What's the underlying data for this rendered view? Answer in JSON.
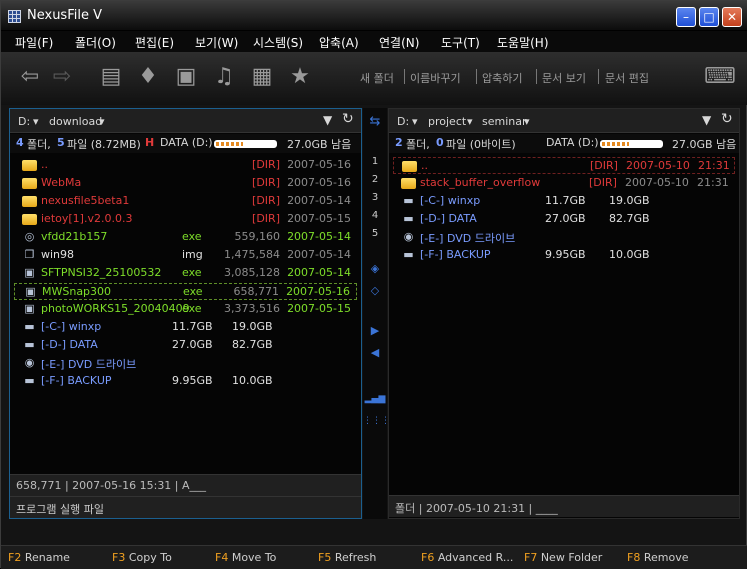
{
  "window": {
    "title": "NexusFile V"
  },
  "menu": [
    "파일(F)",
    "폴더(O)",
    "편집(E)",
    "보기(W)",
    "시스템(S)",
    "압축(A)",
    "연결(N)",
    "도구(T)",
    "도움말(H)"
  ],
  "toolbar": {
    "text_buttons": [
      "새 폴더",
      "이름바꾸기",
      "압축하기",
      "문서 보기",
      "문서 편집"
    ]
  },
  "left": {
    "drive": "D:",
    "path": "download",
    "summary_folders": "4",
    "summary_folders_label": "폴더,",
    "summary_files": "5",
    "summary_files_label": "파일 (8.72MB)",
    "summary_flag": "H",
    "drive_label": "DATA (D:)",
    "drive_fill": 0.45,
    "free": "27.0GB 남음",
    "rows": [
      {
        "icon": "folder",
        "name": "..",
        "type": "",
        "size": "[DIR]",
        "date": "2007-05-16",
        "color": "red"
      },
      {
        "icon": "folder",
        "name": "WebMa",
        "type": "",
        "size": "[DIR]",
        "date": "2007-05-16",
        "color": "red"
      },
      {
        "icon": "folder",
        "name": "nexusfile5beta1",
        "type": "",
        "size": "[DIR]",
        "date": "2007-05-14",
        "color": "red"
      },
      {
        "icon": "folder",
        "name": "ietoy[1].v2.0.0.3",
        "type": "",
        "size": "[DIR]",
        "date": "2007-05-15",
        "color": "red"
      },
      {
        "icon": "cd",
        "name": "vfdd21b157",
        "type": "exe",
        "size": "559,160",
        "date": "2007-05-14",
        "color": "green"
      },
      {
        "icon": "doc",
        "name": "win98",
        "type": "img",
        "size": "1,475,584",
        "date": "2007-05-14",
        "color": "white"
      },
      {
        "icon": "app",
        "name": "SFTPNSI32_25100532",
        "type": "exe",
        "size": "3,085,128",
        "date": "2007-05-14",
        "color": "green"
      },
      {
        "icon": "app",
        "name": "MWSnap300",
        "type": "exe",
        "size": "658,771",
        "date": "2007-05-16",
        "color": "green"
      },
      {
        "icon": "app",
        "name": "photoWORKS15_20040409",
        "type": "exe",
        "size": "3,373,516",
        "date": "2007-05-15",
        "color": "green"
      },
      {
        "icon": "drive",
        "name": "[-C-] winxp",
        "type": "11.7GB",
        "size": "19.0GB",
        "date": "",
        "color": "blue"
      },
      {
        "icon": "drive",
        "name": "[-D-] DATA",
        "type": "27.0GB",
        "size": "82.7GB",
        "date": "",
        "color": "blue"
      },
      {
        "icon": "dvd",
        "name": "[-E-] DVD 드라이브",
        "type": "",
        "size": "",
        "date": "",
        "color": "blue"
      },
      {
        "icon": "drive",
        "name": "[-F-] BACKUP",
        "type": "9.95GB",
        "size": "10.0GB",
        "date": "",
        "color": "blue"
      }
    ],
    "status_line": "658,771 | 2007-05-16 15:31 | A___",
    "description": "프로그램 실행 파일"
  },
  "right": {
    "drive": "D:",
    "path1": "project",
    "path2": "seminar",
    "summary_folders": "2",
    "summary_folders_label": "폴더,",
    "summary_files": "0",
    "summary_files_label": "파일 (0바이트)",
    "drive_label": "DATA (D:)",
    "drive_fill": 0.45,
    "free": "27.0GB 남음",
    "rows": [
      {
        "icon": "folder",
        "name": "..",
        "size": "[DIR]",
        "date": "2007-05-10",
        "time": "21:31",
        "color": "red"
      },
      {
        "icon": "folder",
        "name": "stack_buffer_overflow",
        "size": "[DIR]",
        "date": "2007-05-10",
        "time": "21:31",
        "color": "red"
      },
      {
        "icon": "drive",
        "name": "[-C-] winxp",
        "size": "11.7GB",
        "date": "19.0GB",
        "time": "",
        "color": "blue"
      },
      {
        "icon": "drive",
        "name": "[-D-] DATA",
        "size": "27.0GB",
        "date": "82.7GB",
        "time": "",
        "color": "blue"
      },
      {
        "icon": "dvd",
        "name": "[-E-] DVD 드라이브",
        "size": "",
        "date": "",
        "time": "",
        "color": "blue"
      },
      {
        "icon": "drive",
        "name": "[-F-] BACKUP",
        "size": "9.95GB",
        "date": "10.0GB",
        "time": "",
        "color": "blue"
      }
    ],
    "status_line": "폴더 | 2007-05-10 21:31 | ____"
  },
  "middle": {
    "numbers": [
      "1",
      "2",
      "3",
      "4",
      "5"
    ]
  },
  "fkeys": [
    {
      "key": "F2",
      "label": "Rename"
    },
    {
      "key": "F3",
      "label": "Copy To"
    },
    {
      "key": "F4",
      "label": "Move To"
    },
    {
      "key": "F5",
      "label": "Refresh"
    },
    {
      "key": "F6",
      "label": "Advanced R..."
    },
    {
      "key": "F7",
      "label": "New Folder"
    },
    {
      "key": "F8",
      "label": "Remove"
    }
  ]
}
